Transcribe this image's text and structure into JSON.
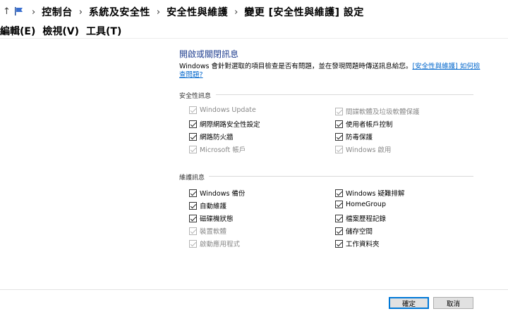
{
  "address_bar": {
    "breadcrumbs": [
      "控制台",
      "系統及安全性",
      "安全性與維護",
      "變更 [安全性與維護] 設定"
    ]
  },
  "menu": {
    "items": [
      "編輯(E)",
      "檢視(V)",
      "工具(T)"
    ]
  },
  "main": {
    "title": "開啟或關閉訊息",
    "description": "Windows 會針對選取的項目檢查是否有問題，並在發現問題時傳送訊息給您。",
    "description_link": "[安全性與維護] 如何檢查問題?",
    "security_section": {
      "label": "安全性訊息",
      "left": [
        {
          "label": "Windows Update",
          "disabled": true
        },
        {
          "label": "網際網路安全性設定",
          "disabled": false
        },
        {
          "label": "網路防火牆",
          "disabled": false
        },
        {
          "label": "Microsoft 帳戶",
          "disabled": true
        }
      ],
      "right": [
        {
          "label": "間諜軟體及垃圾軟體保護",
          "disabled": true
        },
        {
          "label": "使用者帳戶控制",
          "disabled": false
        },
        {
          "label": "防毒保護",
          "disabled": false
        },
        {
          "label": "Windows 啟用",
          "disabled": true
        }
      ]
    },
    "maintenance_section": {
      "label": "維護訊息",
      "left": [
        {
          "label": "Windows 備份",
          "disabled": false
        },
        {
          "label": "自動維護",
          "disabled": false
        },
        {
          "label": "磁碟機狀態",
          "disabled": false
        },
        {
          "label": "裝置軟體",
          "disabled": true
        },
        {
          "label": "啟動應用程式",
          "disabled": true
        }
      ],
      "right": [
        {
          "label": "Windows 疑難排解",
          "disabled": false
        },
        {
          "label": "HomeGroup",
          "disabled": false
        },
        {
          "label": "檔案歷程記錄",
          "disabled": false
        },
        {
          "label": "儲存空間",
          "disabled": false
        },
        {
          "label": "工作資料夾",
          "disabled": false
        }
      ]
    }
  },
  "footer": {
    "ok_label": "確定",
    "cancel_label": "取消"
  }
}
